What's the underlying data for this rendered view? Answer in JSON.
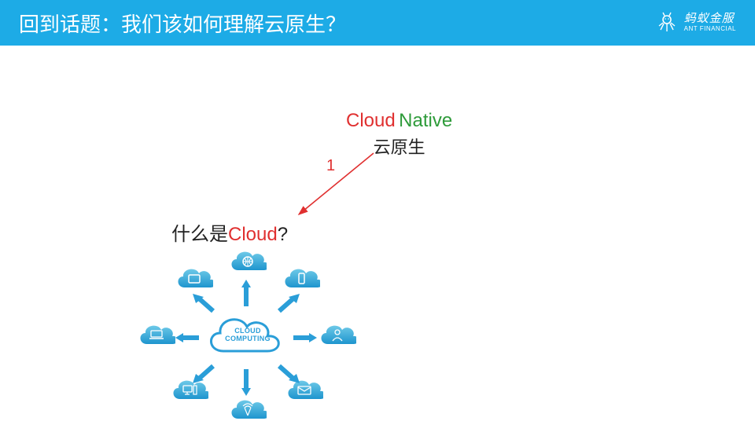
{
  "header": {
    "title": "回到话题：我们该如何理解云原生？"
  },
  "brand": {
    "cn": "蚂蚁金服",
    "en": "ANT FINANCIAL"
  },
  "main": {
    "cloud_word": "Cloud",
    "native_word": "Native",
    "cn_sub": "云原生",
    "arrow_number": "1",
    "question_prefix": "什么是",
    "question_highlight": "Cloud",
    "question_suffix": "?",
    "diagram_center_line1": "CLOUD",
    "diagram_center_line2": "COMPUTING"
  },
  "colors": {
    "header_bg": "#1DABE6",
    "red": "#E03030",
    "green": "#2E9B3A",
    "cloud_blue": "#2A9ED8",
    "cloud_light": "#B5E0F2"
  }
}
